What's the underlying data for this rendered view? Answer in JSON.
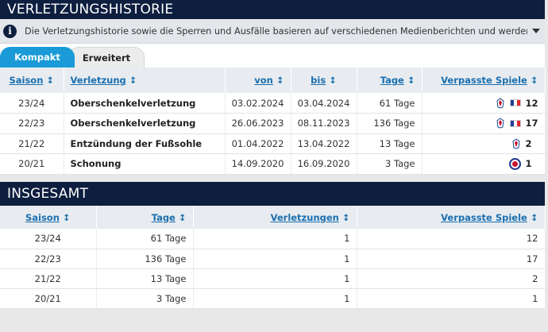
{
  "history": {
    "title": "VERLETZUNGSHISTORIE",
    "notice": "Die Verletzungshistorie sowie die Sperren und Ausfälle basieren auf verschiedenen Medienberichten und werden mit größtmöglicher Sorgfalt r...",
    "tabs": [
      {
        "label": "Kompakt",
        "active": true
      },
      {
        "label": "Erweitert",
        "active": false
      }
    ],
    "sort_glyph": "↕",
    "columns": {
      "season": "Saison",
      "injury": "Verletzung",
      "from": "von",
      "until": "bis",
      "days": "Tage",
      "missed": "Verpasste Spiele"
    },
    "rows": [
      {
        "season": "23/24",
        "injury": "Oberschenkelverletzung",
        "from": "03.02.2024",
        "until": "03.04.2024",
        "days": "61 Tage",
        "missed": "12",
        "icons": [
          "palace-crest-icon",
          "france-flag-icon"
        ]
      },
      {
        "season": "22/23",
        "injury": "Oberschenkelverletzung",
        "from": "26.06.2023",
        "until": "08.11.2023",
        "days": "136 Tage",
        "missed": "17",
        "icons": [
          "palace-crest-icon",
          "france-flag-icon"
        ]
      },
      {
        "season": "21/22",
        "injury": "Entzündung der Fußsohle",
        "from": "01.04.2022",
        "until": "13.04.2022",
        "days": "13 Tage",
        "missed": "2",
        "icons": [
          "palace-crest-icon"
        ]
      },
      {
        "season": "20/21",
        "injury": "Schonung",
        "from": "14.09.2020",
        "until": "16.09.2020",
        "days": "3 Tage",
        "missed": "1",
        "icons": [
          "reading-crest-icon"
        ]
      }
    ]
  },
  "totals": {
    "title": "INSGESAMT",
    "columns": {
      "season": "Saison",
      "days": "Tage",
      "injuries": "Verletzungen",
      "missed": "Verpasste Spiele"
    },
    "rows": [
      {
        "season": "23/24",
        "days": "61 Tage",
        "injuries": "1",
        "missed": "12"
      },
      {
        "season": "22/23",
        "days": "136 Tage",
        "injuries": "1",
        "missed": "17"
      },
      {
        "season": "21/22",
        "days": "13 Tage",
        "injuries": "1",
        "missed": "2"
      },
      {
        "season": "20/21",
        "days": "3 Tage",
        "injuries": "1",
        "missed": "1"
      }
    ]
  },
  "colors": {
    "header_bg": "#0d1e3f",
    "accent": "#1a9bd8",
    "link": "#1a6fb0"
  }
}
